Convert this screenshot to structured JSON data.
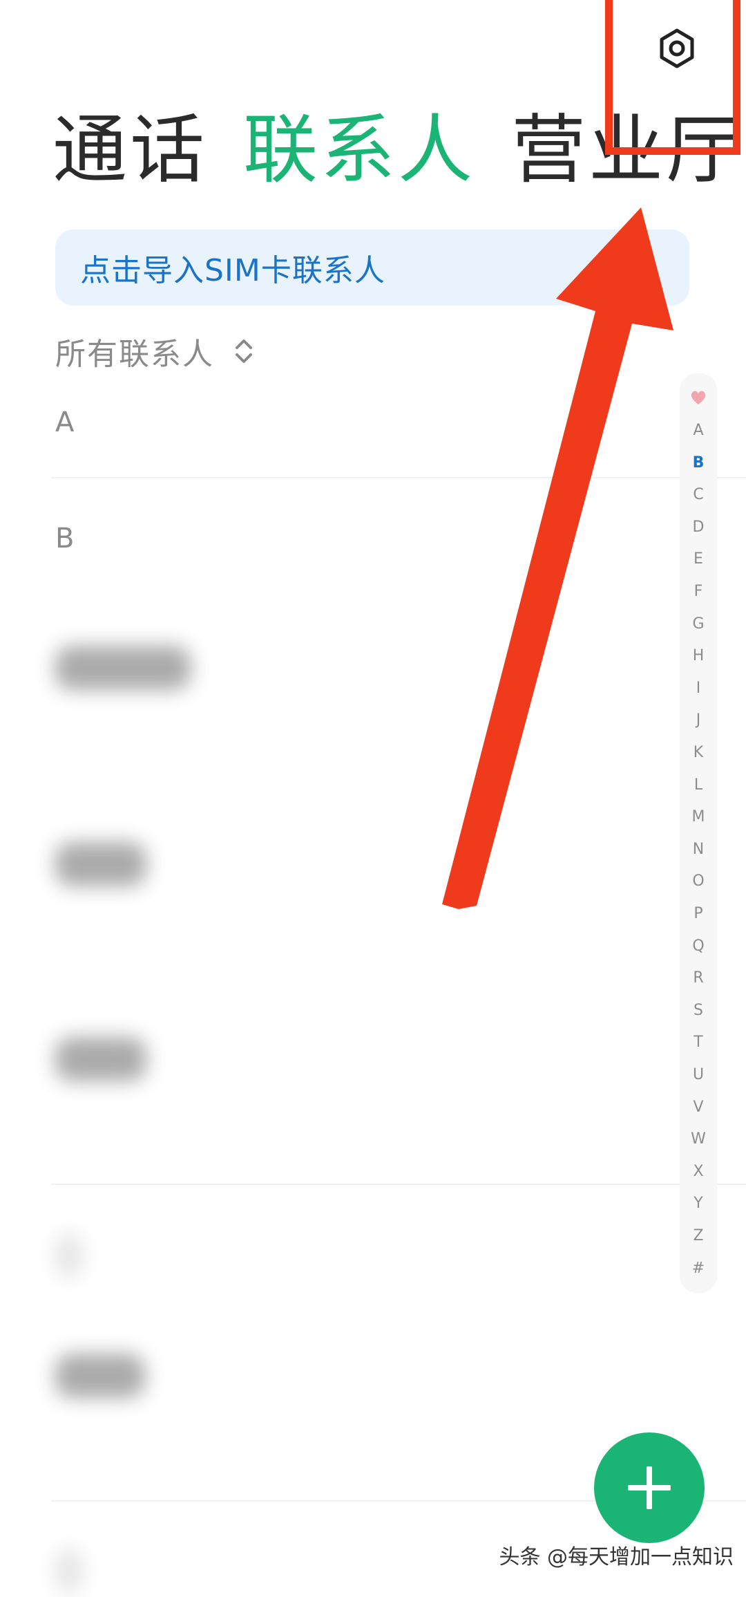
{
  "tabs": [
    {
      "label": "通话",
      "active": false
    },
    {
      "label": "联系人",
      "active": true
    },
    {
      "label": "营业厅",
      "active": false
    }
  ],
  "sim_banner": {
    "label": "点击导入SIM卡联系人"
  },
  "filter": {
    "label": "所有联系人",
    "icon": "sort-chevron-icon"
  },
  "sections": [
    "A",
    "B"
  ],
  "alphabet": [
    "A",
    "B",
    "C",
    "D",
    "E",
    "F",
    "G",
    "H",
    "I",
    "J",
    "K",
    "L",
    "M",
    "N",
    "O",
    "P",
    "Q",
    "R",
    "S",
    "T",
    "U",
    "V",
    "W",
    "X",
    "Y",
    "Z",
    "#"
  ],
  "alphabet_active": "B",
  "colors": {
    "accent_green": "#1ab574",
    "link_blue": "#1a73c7",
    "annotation_red": "#f03a1c"
  },
  "icons": {
    "settings": "gear-icon",
    "favorites": "heart-icon",
    "add": "plus-icon"
  },
  "watermark": "头条 @每天增加一点知识"
}
